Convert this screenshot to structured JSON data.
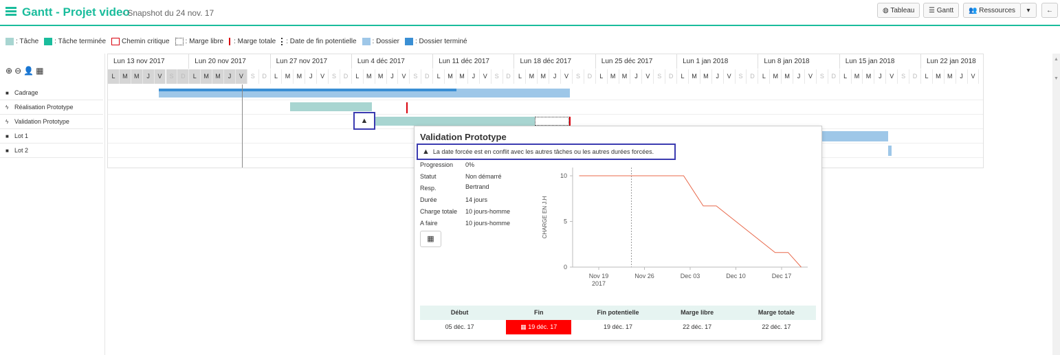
{
  "header": {
    "title": "Gantt - Projet video",
    "subtitle": "- Snapshot du 24 nov. 17",
    "buttons": {
      "tableau": "Tableau",
      "gantt": "Gantt",
      "ressources": "Ressources"
    },
    "accent_color": "#1abc9c"
  },
  "legend": [
    {
      "label": ": Tâche",
      "color": "#a8d5d1"
    },
    {
      "label": ": Tâche terminée",
      "color": "#1abc9c"
    },
    {
      "label": "Chemin critique",
      "color": "#d9000d"
    },
    {
      "label": ": Marge libre",
      "color": "#333333"
    },
    {
      "label": ": Marge totale",
      "color": "#d9000d"
    },
    {
      "label": ": Date de fin potentielle",
      "color": "#333333"
    },
    {
      "label": ": Dossier",
      "color": "#9ec7e8"
    },
    {
      "label": ": Dossier terminé",
      "color": "#3a8fd4"
    }
  ],
  "tasks": [
    {
      "label": "Cadrage",
      "icon": "folder-icon"
    },
    {
      "label": "Réalisation Prototype",
      "icon": "bolt-icon"
    },
    {
      "label": "Validation Prototype",
      "icon": "bolt-icon"
    },
    {
      "label": "Lot 1",
      "icon": "folder-icon"
    },
    {
      "label": "Lot 2",
      "icon": "folder-icon"
    }
  ],
  "weeks": [
    "Lun 13 nov 2017",
    "Lun 20 nov 2017",
    "Lun 27 nov 2017",
    "Lun 4 déc 2017",
    "Lun 11 déc 2017",
    "Lun 18 déc 2017",
    "Lun 25 déc 2017",
    "Lun 1 jan 2018",
    "Lun 8 jan 2018",
    "Lun 15 jan 2018",
    "Lun 22 jan 2018"
  ],
  "days": [
    "L",
    "M",
    "M",
    "J",
    "V",
    "S",
    "D"
  ],
  "popup": {
    "title": "Validation Prototype",
    "warning": "La date forcée est en conflit avec les autres tâches ou les autres durées forcées.",
    "fields": [
      {
        "label": "Progression",
        "value": "0%"
      },
      {
        "label": "Statut",
        "value": "Non démarré"
      },
      {
        "label": "Resp.",
        "value": "Bertrand"
      },
      {
        "label": "Durée",
        "value": "14 jours"
      },
      {
        "label": "Charge totale",
        "value": "10 jours-homme"
      },
      {
        "label": "A faire",
        "value": "10 jours-homme"
      }
    ],
    "table": {
      "headers": [
        "Début",
        "Fin",
        "Fin potentielle",
        "Marge libre",
        "Marge totale"
      ],
      "values": [
        "05 déc. 17",
        "19 déc. 17",
        "19 déc. 17",
        "22 déc. 17",
        "22 déc. 17"
      ]
    }
  },
  "chart_data": {
    "type": "line",
    "ylabel": "CHARGE EN J.H",
    "ylim": [
      0,
      10
    ],
    "yticks": [
      0,
      5,
      10
    ],
    "xticks": [
      "Nov 19\n2017",
      "Nov 26",
      "Dec 03",
      "Dec 10",
      "Dec 17"
    ],
    "series": [
      {
        "values": [
          [
            -3,
            10
          ],
          [
            0,
            10
          ],
          [
            7,
            10
          ],
          [
            10,
            10
          ],
          [
            13,
            10
          ],
          [
            16,
            6.7
          ],
          [
            18,
            6.7
          ],
          [
            27,
            1.6
          ],
          [
            29,
            1.6
          ],
          [
            31,
            0
          ]
        ]
      }
    ],
    "vline_x": 5,
    "color": "#e8684a"
  }
}
